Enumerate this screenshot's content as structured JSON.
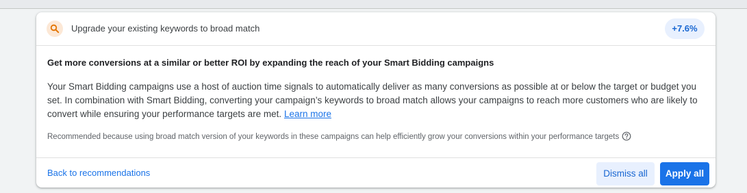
{
  "recommendation": {
    "title": "Upgrade your existing keywords to broad match",
    "uplift": "+7.6%",
    "headline": "Get more conversions at a similar or better ROI by expanding the reach of your Smart Bidding campaigns",
    "description": "Your Smart Bidding campaigns use a host of auction time signals to automatically deliver as many conversions as possible at or below the target or budget you set. In combination with Smart Bidding, converting your campaign’s keywords to broad match allows your campaigns to reach more customers who are likely to convert while ensuring your performance targets are met.",
    "learn_more": "Learn more",
    "reason": "Recommended because using broad match version of your keywords in these campaigns can help efficiently grow your conversions within your performance targets"
  },
  "footer": {
    "back_link": "Back to recommendations",
    "dismiss_label": "Dismiss all",
    "apply_label": "Apply all"
  },
  "icons": {
    "header": "search-icon",
    "reason": "help-icon"
  },
  "colors": {
    "accent": "#1a73e8",
    "search_circle_bg": "#fce8d6",
    "search_icon": "#e37400",
    "badge_bg": "#e8f0fe"
  }
}
